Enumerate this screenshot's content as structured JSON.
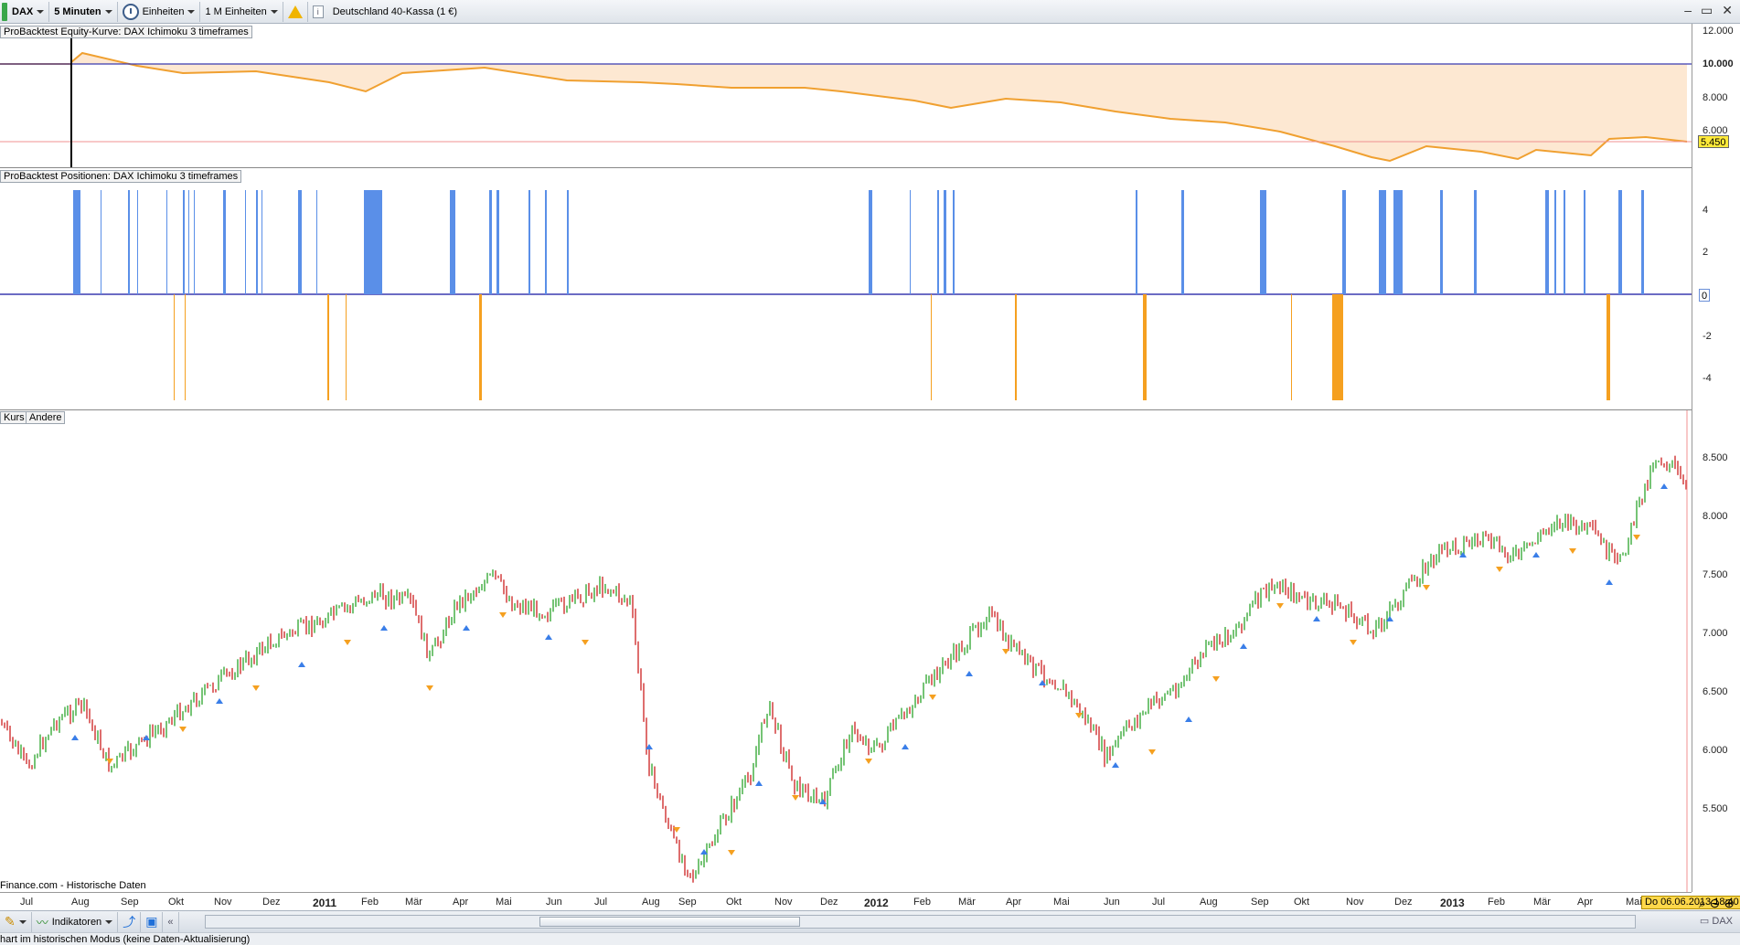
{
  "toolbar": {
    "instrument": "DAX",
    "interval": "5 Minuten",
    "units_label": "Einheiten",
    "range_label": "1 M Einheiten",
    "product": "Deutschland 40-Kassa (1 €)",
    "right_icons": [
      "minimize-icon",
      "restore-icon",
      "close-icon"
    ]
  },
  "equity_panel": {
    "label": "ProBacktest Equity-Kurve: DAX Ichimoku 3 timeframes",
    "ticks": [
      "12.000",
      "10.000",
      "8.000",
      "6.000"
    ],
    "current_value": "5.450",
    "line_color": "#f0a030",
    "fill_color": "#fde8d2",
    "baseline_color": "#3a3ab0"
  },
  "positions_panel": {
    "label": "ProBacktest Positionen: DAX Ichimoku 3 timeframes",
    "ticks": [
      "4",
      "2",
      "0",
      "-2",
      "-4"
    ],
    "long_color": "#5a8fe8",
    "short_color": "#f5a020"
  },
  "price_panel": {
    "tabs": [
      "Kurs",
      "Andere"
    ],
    "ticks": [
      "8.500",
      "8.000",
      "7.500",
      "7.000",
      "6.500",
      "6.000",
      "5.500"
    ],
    "source": "Finance.com - Historische Daten",
    "up_color": "#3aaa3a",
    "down_color": "#d03030"
  },
  "x_axis": {
    "labels": [
      {
        "text": "Jul",
        "bold": false
      },
      {
        "text": "Aug",
        "bold": false
      },
      {
        "text": "Sep",
        "bold": false
      },
      {
        "text": "Okt",
        "bold": false
      },
      {
        "text": "Nov",
        "bold": false
      },
      {
        "text": "Dez",
        "bold": false
      },
      {
        "text": "2011",
        "bold": true
      },
      {
        "text": "Feb",
        "bold": false
      },
      {
        "text": "Mär",
        "bold": false
      },
      {
        "text": "Apr",
        "bold": false
      },
      {
        "text": "Mai",
        "bold": false
      },
      {
        "text": "Jun",
        "bold": false
      },
      {
        "text": "Jul",
        "bold": false
      },
      {
        "text": "Aug",
        "bold": false
      },
      {
        "text": "Sep",
        "bold": false
      },
      {
        "text": "Okt",
        "bold": false
      },
      {
        "text": "Nov",
        "bold": false
      },
      {
        "text": "Dez",
        "bold": false
      },
      {
        "text": "2012",
        "bold": true
      },
      {
        "text": "Feb",
        "bold": false
      },
      {
        "text": "Mär",
        "bold": false
      },
      {
        "text": "Apr",
        "bold": false
      },
      {
        "text": "Mai",
        "bold": false
      },
      {
        "text": "Jun",
        "bold": false
      },
      {
        "text": "Jul",
        "bold": false
      },
      {
        "text": "Aug",
        "bold": false
      },
      {
        "text": "Sep",
        "bold": false
      },
      {
        "text": "Okt",
        "bold": false
      },
      {
        "text": "Nov",
        "bold": false
      },
      {
        "text": "Dez",
        "bold": false
      },
      {
        "text": "2013",
        "bold": true
      },
      {
        "text": "Feb",
        "bold": false
      },
      {
        "text": "Mär",
        "bold": false
      },
      {
        "text": "Apr",
        "bold": false
      },
      {
        "text": "Mai",
        "bold": false
      }
    ],
    "cursor_date": "Do 06.06.2013 18:40"
  },
  "bottom_bar": {
    "indicators_label": "Indikatoren",
    "instrument_tag": "DAX"
  },
  "status": {
    "text": "hart im historischen Modus (keine Daten-Aktualisierung)"
  }
}
